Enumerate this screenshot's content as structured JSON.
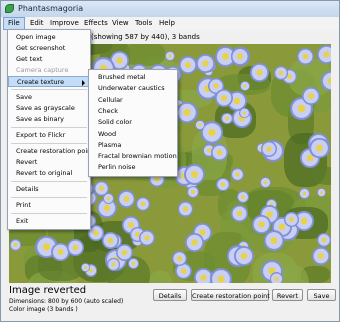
{
  "window": {
    "title": "Phantasmagoria"
  },
  "menubar": [
    "File",
    "Edit",
    "Improve",
    "Effects",
    "View",
    "Tools",
    "Help"
  ],
  "image_info": "(showing 587 by 440), 3 bands",
  "file_menu": [
    {
      "label": "Open image"
    },
    {
      "label": "Get screenshot"
    },
    {
      "label": "Get text"
    },
    {
      "label": "Camera capture",
      "disabled": true
    },
    {
      "label": "Create texture",
      "submenu": true
    },
    {
      "separator": true
    },
    {
      "label": "Save"
    },
    {
      "label": "Save as grayscale"
    },
    {
      "label": "Save as binary"
    },
    {
      "separator": true
    },
    {
      "label": "Export to Flickr"
    },
    {
      "separator": true
    },
    {
      "label": "Create restoration point"
    },
    {
      "label": "Revert"
    },
    {
      "label": "Revert to original"
    },
    {
      "separator": true
    },
    {
      "label": "Details"
    },
    {
      "separator": true
    },
    {
      "label": "Print"
    },
    {
      "separator": true
    },
    {
      "label": "Exit"
    }
  ],
  "texture_submenu": [
    "Brushed metal",
    "Underwater caustics",
    "Cellular",
    "Check",
    "Solid color",
    "Wood",
    "Plasma",
    "Fractal brownian motion",
    "Perlin noise"
  ],
  "status": {
    "title": "Image reverted",
    "dimensions": "Dimensions: 800 by 600 (auto scaled)",
    "color": "Color image (3 bands )"
  },
  "buttons": {
    "details": "Details",
    "restore": "Create restoration point",
    "revert": "Revert",
    "save": "Save"
  }
}
